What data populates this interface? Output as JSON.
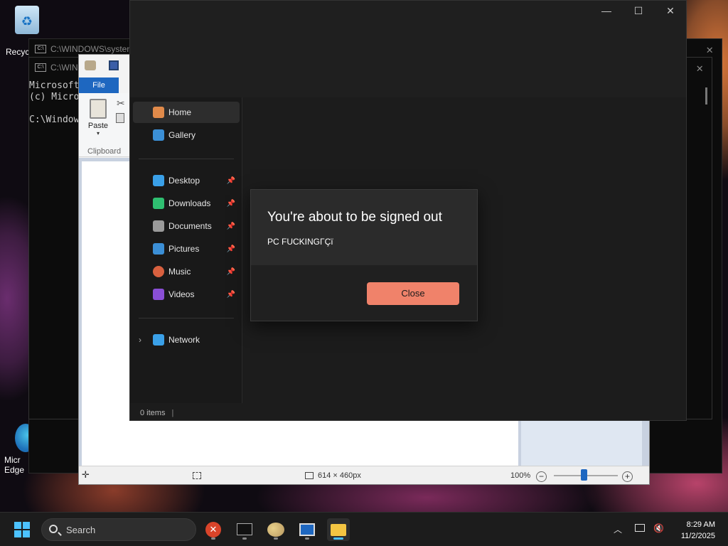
{
  "desktop": {
    "icons": [
      {
        "label": "Recyc",
        "icon": "recycle-bin-icon"
      },
      {
        "label": "Micr\nEdge",
        "icon": "edge-icon"
      }
    ]
  },
  "console_back": {
    "title": "C:\\WINDOWS\\system"
  },
  "console_front": {
    "title": "C:\\WIN",
    "lines": [
      "Microsoft",
      "(c) Micro",
      "",
      "C:\\Window"
    ]
  },
  "paint": {
    "file_tab": "File",
    "paste_label": "Paste",
    "clipboard_label": "Clipboard",
    "status": {
      "dimensions": "614 × 460px",
      "zoom": "100%"
    }
  },
  "explorer": {
    "nav_items": [
      {
        "label": "Home",
        "icon": "home-icon",
        "color": "#e08a4a",
        "selected": true,
        "pinned": false
      },
      {
        "label": "Gallery",
        "icon": "gallery-icon",
        "color": "#3b8fd6",
        "selected": false,
        "pinned": false
      },
      {
        "label": "Desktop",
        "icon": "desktop-icon",
        "color": "#3aa0e8",
        "selected": false,
        "pinned": true
      },
      {
        "label": "Downloads",
        "icon": "downloads-icon",
        "color": "#2fbf71",
        "selected": false,
        "pinned": true
      },
      {
        "label": "Documents",
        "icon": "documents-icon",
        "color": "#9a9a9a",
        "selected": false,
        "pinned": true
      },
      {
        "label": "Pictures",
        "icon": "pictures-icon",
        "color": "#3b8fd6",
        "selected": false,
        "pinned": true
      },
      {
        "label": "Music",
        "icon": "music-icon",
        "color": "#d8603f",
        "selected": false,
        "pinned": true
      },
      {
        "label": "Videos",
        "icon": "videos-icon",
        "color": "#8a4fd6",
        "selected": false,
        "pinned": true
      },
      {
        "label": "Network",
        "icon": "network-icon",
        "color": "#3aa0e8",
        "selected": false,
        "pinned": false
      }
    ],
    "status": "0 items"
  },
  "dialog": {
    "title": "You're about to be signed out",
    "message": "PC FUCKINGΓÇï",
    "close_button": "Close",
    "accent": "#f0826a"
  },
  "taskbar": {
    "search_label": "Search",
    "time": "8:29 AM",
    "date": "11/2/2025",
    "apps": [
      "close-app-icon",
      "terminal-icon",
      "paint-icon",
      "window-app-icon",
      "file-explorer-icon"
    ]
  }
}
